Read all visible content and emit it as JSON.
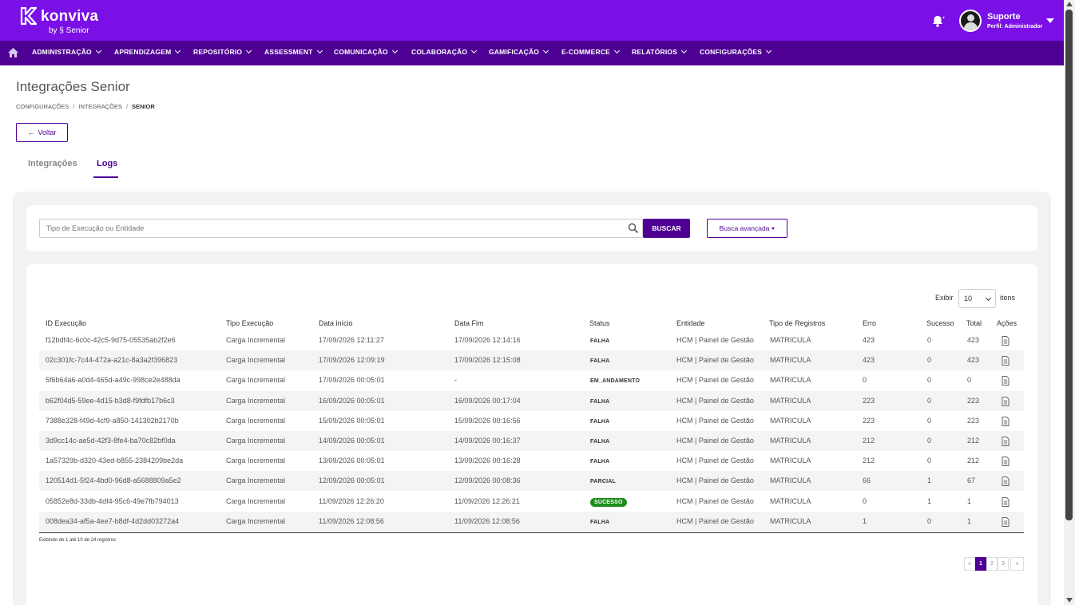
{
  "header": {
    "logo_name": "konviva",
    "logo_by": "by § Senior",
    "user_name": "Suporte",
    "user_role": "Perfil: Administrador",
    "brand_color": "#7a0fe6",
    "nav_color": "#4f0094"
  },
  "nav": {
    "items": [
      "ADMINISTRAÇÃO",
      "APRENDIZAGEM",
      "REPOSITÓRIO",
      "ASSESSMENT",
      "COMUNICAÇÃO",
      "COLABORAÇÃO",
      "GAMIFICAÇÃO",
      "E-COMMERCE",
      "RELATÓRIOS",
      "CONFIGURAÇÕES"
    ]
  },
  "page": {
    "title": "Integrações Senior",
    "breadcrumb": [
      "CONFIGURAÇÕES",
      "INTEGRAÇÕES",
      "SENIOR"
    ],
    "back_label": "Voltar",
    "tabs": [
      "Integrações",
      "Logs"
    ],
    "active_tab": "Logs"
  },
  "search": {
    "placeholder": "Tipo de Execução ou Entidade",
    "button_label": "BUSCAR",
    "advanced_label": "Busca avançada"
  },
  "table": {
    "exibir_label": "Exibir",
    "page_size": "10",
    "itens_label": "itens",
    "columns": [
      "ID Execução",
      "Tipo Execução",
      "Data início",
      "Data Fim",
      "Status",
      "Entidade",
      "Tipo de Registros",
      "Erro",
      "Sucesso",
      "Total",
      "Ações"
    ],
    "rows": [
      [
        "f12bdf4c-6c0c-42c5-9d75-05535ab2f2e6",
        "Carga Incremental",
        "17/09/2026 12:11:27",
        "17/09/2026 12:14:16",
        "FALHA",
        "HCM | Painel de Gestão",
        "MATRICULA",
        "423",
        "0",
        "423"
      ],
      [
        "02c301fc-7c44-472a-a21c-8a3a2f396823",
        "Carga Incremental",
        "17/09/2026 12:09:19",
        "17/09/2026 12:15:08",
        "FALHA",
        "HCM | Painel de Gestão",
        "MATRICULA",
        "423",
        "0",
        "423"
      ],
      [
        "5f6b64a6-a0d4-465d-a49c-998ce2e488da",
        "Carga Incremental",
        "17/09/2026 00:05:01",
        "-",
        "EM_ANDAMENTO",
        "HCM | Painel de Gestão",
        "MATRICULA",
        "0",
        "0",
        "0"
      ],
      [
        "b62f04d5-59ee-4d15-b3d8-f9fdfb17b6c3",
        "Carga Incremental",
        "16/09/2026 00:05:01",
        "16/09/2026 00:17:04",
        "FALHA",
        "HCM | Painel de Gestão",
        "MATRICULA",
        "223",
        "0",
        "223"
      ],
      [
        "7388e328-f49d-4cf9-a850-141302b2170b",
        "Carga Incremental",
        "15/09/2026 00:05:01",
        "15/09/2026 00:16:56",
        "FALHA",
        "HCM | Painel de Gestão",
        "MATRICULA",
        "223",
        "0",
        "223"
      ],
      [
        "3d9cc14c-ae5d-42f3-8fe4-ba70c82bf0da",
        "Carga Incremental",
        "14/09/2026 00:05:01",
        "14/09/2026 00:16:37",
        "FALHA",
        "HCM | Painel de Gestão",
        "MATRICULA",
        "212",
        "0",
        "212"
      ],
      [
        "1a57329b-d320-43ed-b855-2384209be2da",
        "Carga Incremental",
        "13/09/2026 00:05:01",
        "13/09/2026 00:16:28",
        "FALHA",
        "HCM | Painel de Gestão",
        "MATRICULA",
        "212",
        "0",
        "212"
      ],
      [
        "120514d1-5f24-4bd0-96d8-a5688809a5e2",
        "Carga Incremental",
        "12/09/2026 00:05:01",
        "12/09/2026 00:08:36",
        "PARCIAL",
        "HCM | Painel de Gestão",
        "MATRICULA",
        "66",
        "1",
        "67"
      ],
      [
        "05852e8d-33db-4df4-95c6-49e7fb794013",
        "Carga Incremental",
        "11/09/2026 12:26:20",
        "11/09/2026 12:26:21",
        "SUCESSO",
        "HCM | Painel de Gestão",
        "MATRICULA",
        "0",
        "1",
        "1"
      ],
      [
        "008dea34-af5a-4ee7-b8df-4d2dd03272a4",
        "Carga Incremental",
        "11/09/2026 12:08:56",
        "11/09/2026 12:08:56",
        "FALHA",
        "HCM | Painel de Gestão",
        "MATRICULA",
        "1",
        "0",
        "1"
      ]
    ],
    "footer": "Exibindo de 1 até 10 de 24 registros",
    "success_color": "#1e8e1e"
  },
  "pagination": {
    "first": "«",
    "pages": [
      "1",
      "2",
      "3"
    ],
    "last": "»",
    "current": "1"
  }
}
